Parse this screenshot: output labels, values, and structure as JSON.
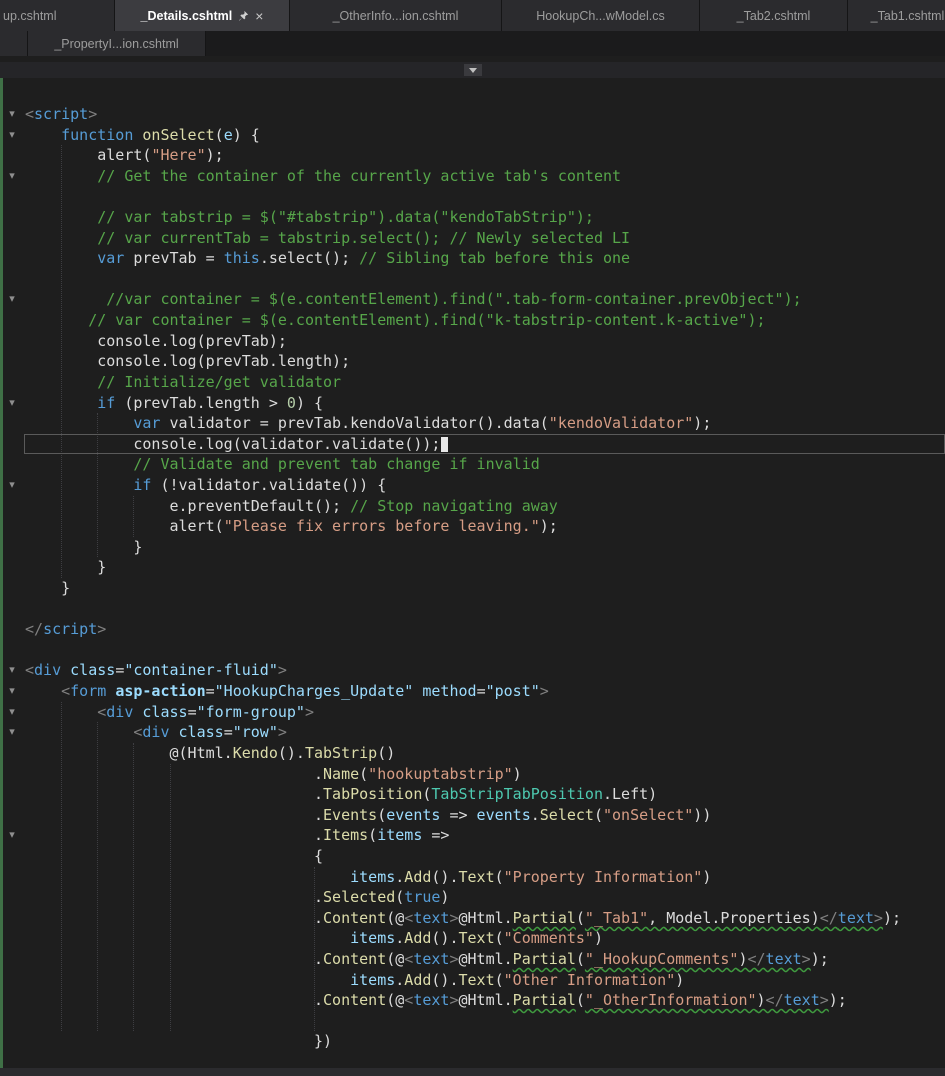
{
  "theme": {
    "editor_bg": "#1e1e1e",
    "tabbar_bg": "#1b1b1c",
    "tab_inactive_bg": "#2b2b2e",
    "tab_active_bg": "#3c3c40",
    "tab_inactive_fg": "#9d9d9d",
    "tab_active_fg": "#ffffff",
    "navbar_bg": "#252528",
    "navbtn_bg": "#3a3a3e",
    "plain": "#dcdcdc",
    "keyword": "#569cd6",
    "method": "#dcdcaa",
    "string": "#d69d85",
    "comment": "#57a64a",
    "type": "#4ec9b0",
    "param": "#9cdcfe",
    "attr_value": "#9cdcfe",
    "punct": "#808080",
    "number": "#b5cea8",
    "squiggle": "#3f9b3f",
    "change_bar": "#3f7046",
    "guide": "#3e3e42",
    "active_line_border": "#5a5a5a",
    "caret": "#e8e8e8"
  },
  "icons": {
    "fold": "▾",
    "close": "×",
    "chevron_down": "▾"
  },
  "tab_rows": {
    "row1": [
      {
        "label": "up.cshtml",
        "state": "inactive",
        "clipped_left": true
      },
      {
        "label": "_Details.cshtml",
        "state": "active",
        "pinned": true,
        "closable": true
      },
      {
        "label": "_OtherInfo...ion.cshtml",
        "state": "inactive"
      },
      {
        "label": "HookupCh...wModel.cs",
        "state": "inactive"
      },
      {
        "label": "_Tab2.cshtml",
        "state": "inactive"
      },
      {
        "label": "_Tab1.cshtml",
        "state": "inactive"
      }
    ],
    "row2": [
      {
        "label": "",
        "state": "inactive",
        "stub": true
      },
      {
        "label": "_PropertyI...ion.cshtml",
        "state": "inactive"
      }
    ]
  },
  "editor": {
    "language": "razor-cshtml",
    "active_line": 16,
    "indent_guides": [
      {
        "col": 4,
        "from": 2,
        "to": 22
      },
      {
        "col": 8,
        "from": 15,
        "to": 21
      },
      {
        "col": 12,
        "from": 19,
        "to": 20
      },
      {
        "col": 4,
        "from": 29,
        "to": 44
      },
      {
        "col": 8,
        "from": 30,
        "to": 44
      },
      {
        "col": 12,
        "from": 31,
        "to": 44
      },
      {
        "col": 16,
        "from": 32,
        "to": 44
      },
      {
        "col": 32,
        "from": 37,
        "to": 44
      }
    ],
    "lines": [
      {
        "fold": true,
        "segs": [
          [
            "<",
            "g"
          ],
          [
            "script",
            "k"
          ],
          [
            ">",
            "g"
          ]
        ]
      },
      {
        "fold": true,
        "segs": [
          [
            "    ",
            "d"
          ],
          [
            "function",
            "k"
          ],
          [
            " ",
            "d"
          ],
          [
            "onSelect",
            "m"
          ],
          [
            "(",
            "d"
          ],
          [
            "e",
            "a"
          ],
          [
            ") {",
            "d"
          ]
        ]
      },
      {
        "segs": [
          [
            "        alert(",
            "d"
          ],
          [
            "\"Here\"",
            "s"
          ],
          [
            ");",
            "d"
          ]
        ]
      },
      {
        "fold": true,
        "segs": [
          [
            "        // Get the container of the currently active tab's content",
            "c"
          ]
        ]
      },
      {
        "segs": []
      },
      {
        "segs": [
          [
            "        // var tabstrip = $(\"#tabstrip\").data(\"kendoTabStrip\");",
            "c"
          ]
        ]
      },
      {
        "segs": [
          [
            "        // var currentTab = tabstrip.select(); // Newly selected LI",
            "c"
          ]
        ]
      },
      {
        "segs": [
          [
            "        ",
            "d"
          ],
          [
            "var",
            "k"
          ],
          [
            " prevTab = ",
            "d"
          ],
          [
            "this",
            "k"
          ],
          [
            ".select(); ",
            "d"
          ],
          [
            "// Sibling tab before this one",
            "c"
          ]
        ]
      },
      {
        "segs": []
      },
      {
        "fold": true,
        "segs": [
          [
            "         //var container = $(e.contentElement).find(\".tab-form-container.prevObject\");",
            "c"
          ]
        ]
      },
      {
        "segs": [
          [
            "       // var container = $(e.contentElement).find(\"k-tabstrip-content.k-active\");",
            "c"
          ]
        ]
      },
      {
        "segs": [
          [
            "        console.log(prevTab);",
            "d"
          ]
        ]
      },
      {
        "segs": [
          [
            "        console.log(prevTab.length);",
            "d"
          ]
        ]
      },
      {
        "segs": [
          [
            "        // Initialize/get validator",
            "c"
          ]
        ]
      },
      {
        "fold": true,
        "segs": [
          [
            "        ",
            "d"
          ],
          [
            "if",
            "k"
          ],
          [
            " (prevTab.length > ",
            "d"
          ],
          [
            "0",
            "n"
          ],
          [
            ") {",
            "d"
          ]
        ]
      },
      {
        "segs": [
          [
            "            ",
            "d"
          ],
          [
            "var",
            "k"
          ],
          [
            " validator = prevTab.kendoValidator().data(",
            "d"
          ],
          [
            "\"kendoValidator\"",
            "s"
          ],
          [
            ");",
            "d"
          ]
        ]
      },
      {
        "active": true,
        "caret": true,
        "segs": [
          [
            "            console.log(validator.validate());",
            "d"
          ]
        ]
      },
      {
        "segs": [
          [
            "            // Validate and prevent tab change if invalid",
            "c"
          ]
        ]
      },
      {
        "fold": true,
        "segs": [
          [
            "            ",
            "d"
          ],
          [
            "if",
            "k"
          ],
          [
            " (!validator.validate()) {",
            "d"
          ]
        ]
      },
      {
        "segs": [
          [
            "                e.preventDefault(); ",
            "d"
          ],
          [
            "// Stop navigating away",
            "c"
          ]
        ]
      },
      {
        "segs": [
          [
            "                alert(",
            "d"
          ],
          [
            "\"Please fix errors before leaving.\"",
            "s"
          ],
          [
            ");",
            "d"
          ]
        ]
      },
      {
        "segs": [
          [
            "            }",
            "d"
          ]
        ]
      },
      {
        "segs": [
          [
            "        }",
            "d"
          ]
        ]
      },
      {
        "segs": [
          [
            "    }",
            "d"
          ]
        ]
      },
      {
        "segs": []
      },
      {
        "segs": [
          [
            "</",
            "g"
          ],
          [
            "script",
            "k"
          ],
          [
            ">",
            "g"
          ]
        ]
      },
      {
        "segs": []
      },
      {
        "fold": true,
        "segs": [
          [
            "<",
            "g"
          ],
          [
            "div",
            "k"
          ],
          [
            " ",
            "d"
          ],
          [
            "class",
            "a"
          ],
          [
            "=",
            "d"
          ],
          [
            "\"container-fluid\"",
            "v"
          ],
          [
            ">",
            "g"
          ]
        ]
      },
      {
        "fold": true,
        "segs": [
          [
            "    ",
            "d"
          ],
          [
            "<",
            "g"
          ],
          [
            "form",
            "k"
          ],
          [
            " ",
            "d"
          ],
          [
            "asp-action",
            "ab"
          ],
          [
            "=",
            "d"
          ],
          [
            "\"HookupCharges_Update\"",
            "v"
          ],
          [
            " ",
            "d"
          ],
          [
            "method",
            "a"
          ],
          [
            "=",
            "d"
          ],
          [
            "\"post\"",
            "v"
          ],
          [
            ">",
            "g"
          ]
        ]
      },
      {
        "fold": true,
        "segs": [
          [
            "        ",
            "d"
          ],
          [
            "<",
            "g"
          ],
          [
            "div",
            "k"
          ],
          [
            " ",
            "d"
          ],
          [
            "class",
            "a"
          ],
          [
            "=",
            "d"
          ],
          [
            "\"form-group\"",
            "v"
          ],
          [
            ">",
            "g"
          ]
        ]
      },
      {
        "fold": true,
        "segs": [
          [
            "            ",
            "d"
          ],
          [
            "<",
            "g"
          ],
          [
            "div",
            "k"
          ],
          [
            " ",
            "d"
          ],
          [
            "class",
            "a"
          ],
          [
            "=",
            "d"
          ],
          [
            "\"row\"",
            "v"
          ],
          [
            ">",
            "g"
          ]
        ]
      },
      {
        "segs": [
          [
            "                @(Html.",
            "d"
          ],
          [
            "Kendo",
            "m"
          ],
          [
            "().",
            "d"
          ],
          [
            "TabStrip",
            "m"
          ],
          [
            "()",
            "d"
          ]
        ]
      },
      {
        "segs": [
          [
            "                                .",
            "d"
          ],
          [
            "Name",
            "m"
          ],
          [
            "(",
            "d"
          ],
          [
            "\"hookuptabstrip\"",
            "s"
          ],
          [
            ")",
            "d"
          ]
        ]
      },
      {
        "segs": [
          [
            "                                .",
            "d"
          ],
          [
            "TabPosition",
            "m"
          ],
          [
            "(",
            "d"
          ],
          [
            "TabStripTabPosition",
            "t"
          ],
          [
            ".Left)",
            "d"
          ]
        ]
      },
      {
        "segs": [
          [
            "                                .",
            "d"
          ],
          [
            "Events",
            "m"
          ],
          [
            "(",
            "d"
          ],
          [
            "events",
            "a"
          ],
          [
            " => ",
            "d"
          ],
          [
            "events",
            "a"
          ],
          [
            ".",
            "d"
          ],
          [
            "Select",
            "m"
          ],
          [
            "(",
            "d"
          ],
          [
            "\"onSelect\"",
            "s"
          ],
          [
            "))",
            "d"
          ]
        ]
      },
      {
        "fold": true,
        "segs": [
          [
            "                                .",
            "d"
          ],
          [
            "Items",
            "m"
          ],
          [
            "(",
            "d"
          ],
          [
            "items",
            "a"
          ],
          [
            " =>",
            "d"
          ]
        ]
      },
      {
        "segs": [
          [
            "                                {",
            "d"
          ]
        ]
      },
      {
        "segs": [
          [
            "                                    ",
            "d"
          ],
          [
            "items",
            "a"
          ],
          [
            ".",
            "d"
          ],
          [
            "Add",
            "m"
          ],
          [
            "().",
            "d"
          ],
          [
            "Text",
            "m"
          ],
          [
            "(",
            "d"
          ],
          [
            "\"Property Information\"",
            "s"
          ],
          [
            ")",
            "d"
          ]
        ]
      },
      {
        "segs": [
          [
            "                                .",
            "d"
          ],
          [
            "Selected",
            "m"
          ],
          [
            "(",
            "d"
          ],
          [
            "true",
            "k"
          ],
          [
            ")",
            "d"
          ]
        ]
      },
      {
        "segs": [
          [
            "                                .",
            "d"
          ],
          [
            "Content",
            "m"
          ],
          [
            "(@",
            "d"
          ],
          [
            "<",
            "g"
          ],
          [
            "text",
            "k"
          ],
          [
            ">",
            "g"
          ],
          [
            "@Html.",
            "d"
          ],
          [
            "Partial",
            "mu"
          ],
          [
            "(",
            "d"
          ],
          [
            "\"_Tab1\"",
            "s sq"
          ],
          [
            ", Model.Properties)",
            "d sq"
          ],
          [
            "</",
            "g sq"
          ],
          [
            "text",
            "k sq"
          ],
          [
            ">",
            "g sq"
          ],
          [
            ");",
            "d"
          ]
        ]
      },
      {
        "segs": [
          [
            "                                    ",
            "d"
          ],
          [
            "items",
            "a"
          ],
          [
            ".",
            "d"
          ],
          [
            "Add",
            "m"
          ],
          [
            "().",
            "d"
          ],
          [
            "Text",
            "m"
          ],
          [
            "(",
            "d"
          ],
          [
            "\"Comments\"",
            "s"
          ],
          [
            ")",
            "d"
          ]
        ]
      },
      {
        "segs": [
          [
            "                                .",
            "d"
          ],
          [
            "Content",
            "m"
          ],
          [
            "(@",
            "d"
          ],
          [
            "<",
            "g"
          ],
          [
            "text",
            "k"
          ],
          [
            ">",
            "g"
          ],
          [
            "@Html.",
            "d"
          ],
          [
            "Partial",
            "mu"
          ],
          [
            "(",
            "d"
          ],
          [
            "\"_HookupComments\"",
            "s sq"
          ],
          [
            ")",
            "d sq"
          ],
          [
            "</",
            "g sq"
          ],
          [
            "text",
            "k sq"
          ],
          [
            ">",
            "g sq"
          ],
          [
            ");",
            "d"
          ]
        ]
      },
      {
        "segs": [
          [
            "                                    ",
            "d"
          ],
          [
            "items",
            "a"
          ],
          [
            ".",
            "d"
          ],
          [
            "Add",
            "m"
          ],
          [
            "().",
            "d"
          ],
          [
            "Text",
            "m"
          ],
          [
            "(",
            "d"
          ],
          [
            "\"Other Information\"",
            "s"
          ],
          [
            ")",
            "d"
          ]
        ]
      },
      {
        "segs": [
          [
            "                                .",
            "d"
          ],
          [
            "Content",
            "m"
          ],
          [
            "(@",
            "d"
          ],
          [
            "<",
            "g"
          ],
          [
            "text",
            "k"
          ],
          [
            ">",
            "g"
          ],
          [
            "@Html.",
            "d"
          ],
          [
            "Partial",
            "mu"
          ],
          [
            "(",
            "d"
          ],
          [
            "\"_OtherInformation\"",
            "s sq"
          ],
          [
            ")",
            "d sq"
          ],
          [
            "</",
            "g sq"
          ],
          [
            "text",
            "k sq"
          ],
          [
            ">",
            "g sq"
          ],
          [
            ");",
            "d"
          ]
        ]
      },
      {
        "segs": []
      },
      {
        "segs": [
          [
            "                                })",
            "d"
          ]
        ]
      }
    ]
  }
}
